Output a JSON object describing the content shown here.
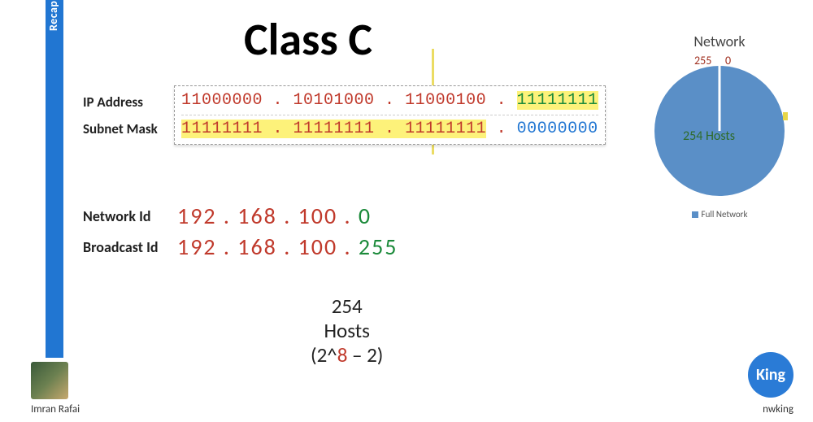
{
  "sidebar": {
    "label": "Recap"
  },
  "title": "Class C",
  "labels": {
    "ip": "IP Address",
    "subnet": "Subnet Mask",
    "network_id": "Network Id",
    "broadcast_id": "Broadcast Id"
  },
  "binary": {
    "ip_oct1": "11000000",
    "ip_oct2": "10101000",
    "ip_oct3": "11000100",
    "ip_oct4": "11111111",
    "sm_oct1": "11111111",
    "sm_oct2": "11111111",
    "sm_oct3": "11111111",
    "sm_oct4": "00000000",
    "dot": " . "
  },
  "decimal": {
    "net_prefix": "192 . 168 . 100 . ",
    "net_last": "0",
    "bcast_prefix": "192 . 168 . 100 . ",
    "bcast_last": "255"
  },
  "hosts": {
    "count": "254",
    "word": "Hosts",
    "formula_pre": "(2^",
    "formula_exp": "8",
    "formula_post": " – 2)"
  },
  "pie": {
    "title": "Network",
    "label_255": "255",
    "label_0": "0",
    "center": "254 Hosts",
    "legend": "Full Network"
  },
  "footer": {
    "presenter": "Imran Rafai",
    "brand": "King",
    "site": "nwking"
  },
  "chart_data": {
    "type": "pie",
    "title": "Network",
    "series": [
      {
        "name": "Full Network",
        "value": 254
      }
    ],
    "annotations": [
      "255",
      "0",
      "254 Hosts"
    ],
    "legend_position": "bottom"
  }
}
